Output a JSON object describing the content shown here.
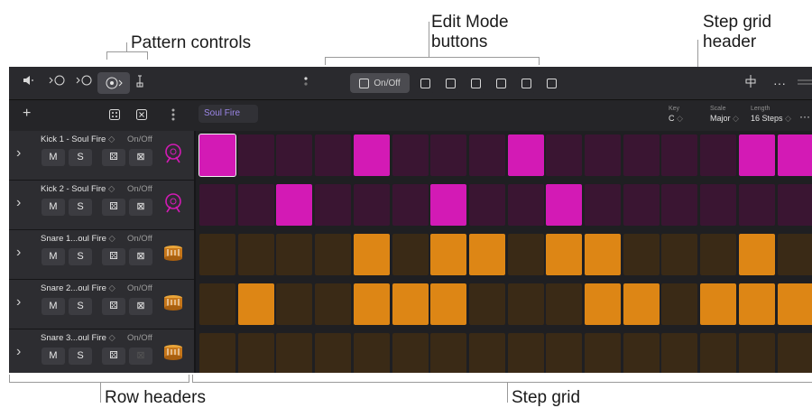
{
  "callouts": {
    "pattern_controls": "Pattern controls",
    "edit_mode_line1": "Edit Mode",
    "edit_mode_line2": "buttons",
    "step_grid_header_line1": "Step grid",
    "step_grid_header_line2": "header",
    "row_headers": "Row headers",
    "step_grid": "Step grid"
  },
  "toolbar": {
    "edit_modes": [
      {
        "label": "On/Off",
        "icon": "step-on-off-icon",
        "active": true
      },
      {
        "label": "",
        "icon": "velocity-icon",
        "active": false
      },
      {
        "label": "",
        "icon": "note-repeat-icon",
        "active": false
      },
      {
        "label": "",
        "icon": "chance-icon",
        "active": false
      },
      {
        "label": "",
        "icon": "offset-icon",
        "active": false
      },
      {
        "label": "",
        "icon": "row-settings-icon",
        "active": false
      },
      {
        "label": "",
        "icon": "select-icon",
        "active": false
      }
    ]
  },
  "pattern": {
    "add_label": "+",
    "name": "Soul Fire"
  },
  "grid_header": {
    "key_label": "Key",
    "key_value": "C",
    "scale_label": "Scale",
    "scale_value": "Major",
    "length_label": "Length",
    "length_value": "16 Steps",
    "more_label": "···"
  },
  "colors": {
    "kick_on": "#d31ab5",
    "kick_off": "#3a1532",
    "snare_on": "#dd8615",
    "snare_off": "#3a2a16"
  },
  "rows": [
    {
      "name": "Kick 1 - Soul Fire",
      "mode": "On/Off",
      "mute": "M",
      "solo": "S",
      "instrument": "kick-drum-icon",
      "kind": "kick",
      "steps": [
        1,
        0,
        0,
        0,
        1,
        0,
        0,
        0,
        1,
        0,
        0,
        0,
        0,
        0,
        1,
        1
      ]
    },
    {
      "name": "Kick 2 - Soul Fire",
      "mode": "On/Off",
      "mute": "M",
      "solo": "S",
      "instrument": "kick-drum-icon",
      "kind": "kick",
      "steps": [
        0,
        0,
        1,
        0,
        0,
        0,
        1,
        0,
        0,
        1,
        0,
        0,
        0,
        0,
        0,
        0
      ]
    },
    {
      "name": "Snare 1...oul Fire",
      "mode": "On/Off",
      "mute": "M",
      "solo": "S",
      "instrument": "snare-drum-icon",
      "kind": "snare",
      "steps": [
        0,
        0,
        0,
        0,
        1,
        0,
        1,
        1,
        0,
        1,
        1,
        0,
        0,
        0,
        1,
        0
      ]
    },
    {
      "name": "Snare 2...oul Fire",
      "mode": "On/Off",
      "mute": "M",
      "solo": "S",
      "instrument": "snare-drum-icon",
      "kind": "snare",
      "steps": [
        0,
        1,
        0,
        0,
        1,
        1,
        1,
        0,
        0,
        0,
        1,
        1,
        0,
        1,
        1,
        1
      ]
    },
    {
      "name": "Snare 3...oul Fire",
      "mode": "On/Off",
      "mute": "M",
      "solo": "S",
      "instrument": "snare-drum-icon",
      "kind": "snare",
      "steps": [
        0,
        0,
        0,
        0,
        0,
        0,
        0,
        0,
        0,
        0,
        0,
        0,
        0,
        0,
        0,
        0
      ]
    }
  ]
}
